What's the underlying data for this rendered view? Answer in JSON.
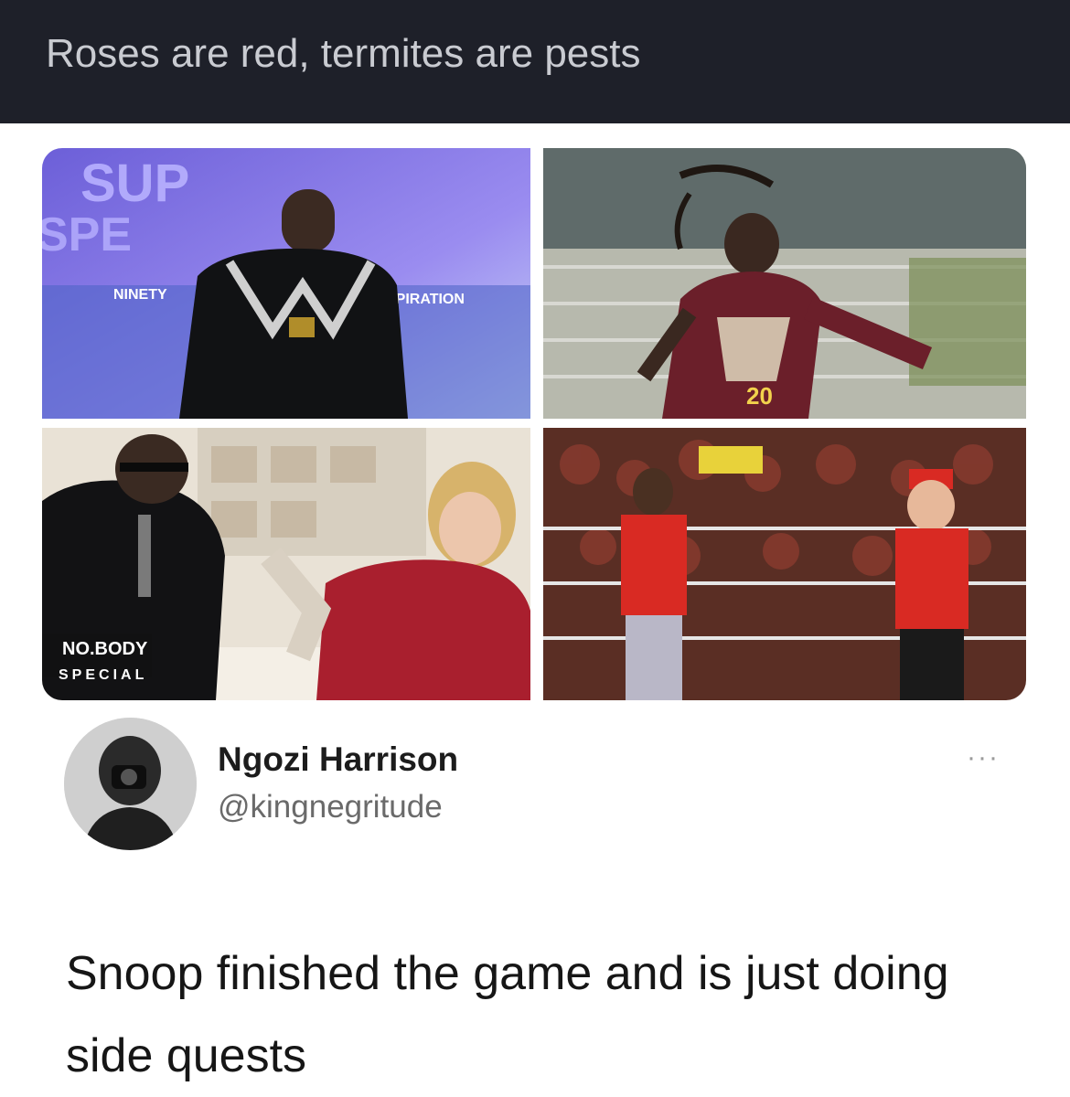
{
  "post": {
    "title": "Roses are red, termites are pests"
  },
  "media": {
    "photos": [
      {
        "id": "photo-stage",
        "texts": [
          "SUP",
          "SPE",
          "NINETY",
          "INSPIRATION"
        ]
      },
      {
        "id": "photo-football",
        "texts": [
          "20"
        ]
      },
      {
        "id": "photo-kitchen",
        "texts": [
          "NO.BODY",
          "SPECIAL"
        ]
      },
      {
        "id": "photo-wrestling",
        "texts": []
      }
    ]
  },
  "tweet": {
    "author_name": "Ngozi Harrison",
    "author_handle": "@kingnegritude",
    "more_label": "···",
    "text": "Snoop finished the game and is just doing side quests"
  },
  "colors": {
    "header_bg": "#1e2029",
    "header_text": "#c9cbd1",
    "card_bg": "#ffffff"
  }
}
